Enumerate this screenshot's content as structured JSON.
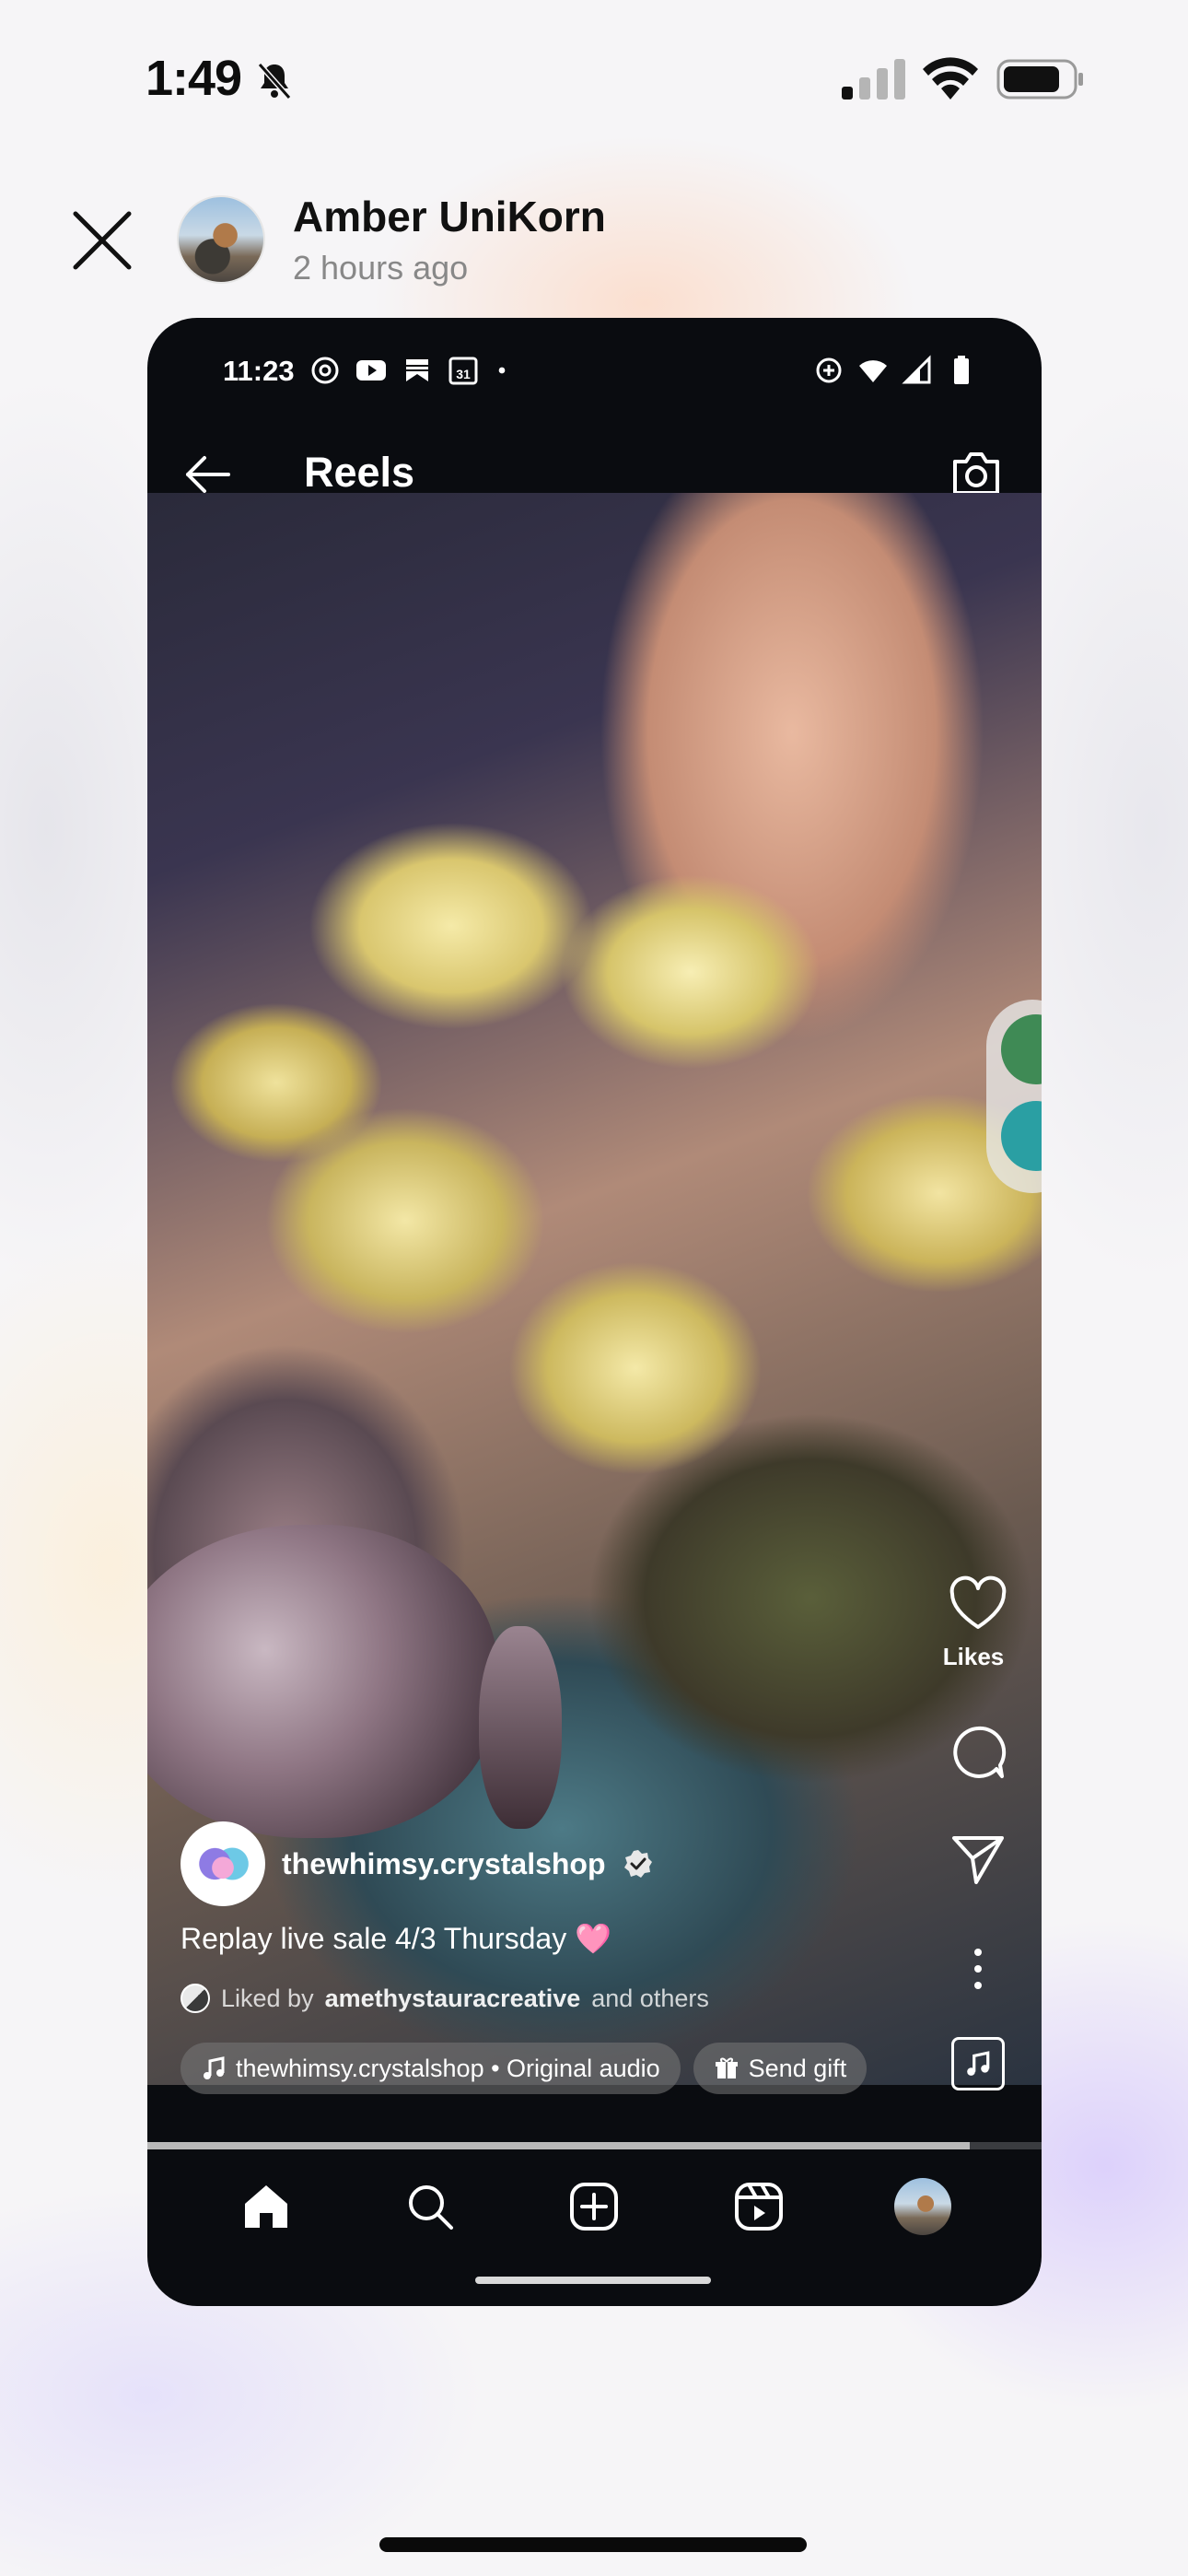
{
  "ios_status": {
    "time": "1:49"
  },
  "story": {
    "author": "Amber UniKorn",
    "posted": "2 hours ago"
  },
  "shared_screenshot": {
    "status": {
      "time": "11:23",
      "calendar_day": "31"
    },
    "header": {
      "title": "Reels"
    },
    "reel": {
      "likes_label": "Likes",
      "account": "thewhimsy.crystalshop",
      "caption": "Replay live sale 4/3 Thursday",
      "caption_emoji": "🩷",
      "liked_by_prefix": "Liked by",
      "liked_by_user": "amethystauracreative",
      "liked_by_suffix": "and others",
      "audio_label": "thewhimsy.crystalshop • Original audio",
      "gift_label": "Send gift",
      "progress": 0.92
    },
    "nav_icons": [
      "home-icon",
      "search-icon",
      "create-icon",
      "reels-icon",
      "profile-avatar"
    ]
  },
  "colors": {
    "phone_bg": "#0a0c10",
    "heart_emoji": "#ff86c8",
    "page_bg": "#f6f5f7"
  }
}
